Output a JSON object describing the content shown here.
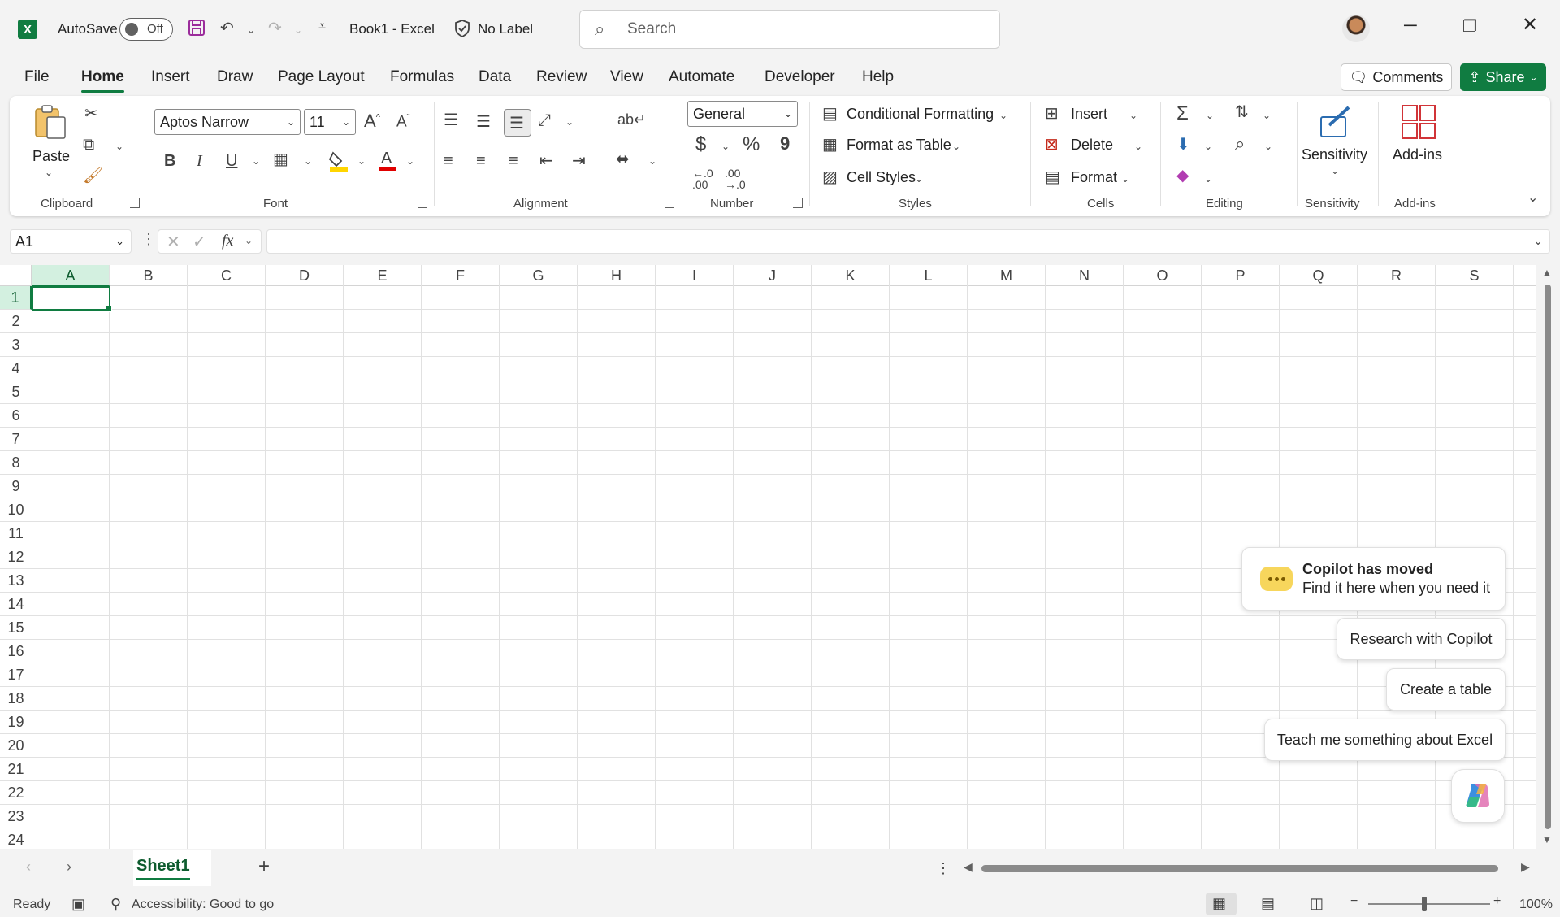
{
  "titlebar": {
    "autosave_label": "AutoSave",
    "autosave_state": "Off",
    "doc_title": "Book1  -  Excel",
    "sensitivity_label": "No Label",
    "search_placeholder": "Search"
  },
  "tabs": [
    "File",
    "Home",
    "Insert",
    "Draw",
    "Page Layout",
    "Formulas",
    "Data",
    "Review",
    "View",
    "Automate",
    "Developer",
    "Help"
  ],
  "active_tab": "Home",
  "comments_label": "Comments",
  "share_label": "Share",
  "ribbon": {
    "clipboard": {
      "paste": "Paste",
      "group": "Clipboard"
    },
    "font": {
      "name": "Aptos Narrow",
      "size": "11",
      "group": "Font",
      "bold": "B",
      "italic": "I",
      "underline": "U",
      "fill_color": "#ffd500",
      "font_color": "#e00000"
    },
    "alignment": {
      "group": "Alignment"
    },
    "number": {
      "format": "General",
      "group": "Number",
      "currency": "$",
      "percent": "%",
      "comma": "9"
    },
    "styles": {
      "conditional": "Conditional Formatting",
      "format_table": "Format as Table",
      "cell_styles": "Cell Styles",
      "group": "Styles"
    },
    "cells": {
      "insert": "Insert",
      "delete": "Delete",
      "format": "Format",
      "group": "Cells"
    },
    "editing": {
      "group": "Editing"
    },
    "sensitivity": {
      "label": "Sensitivity",
      "group": "Sensitivity"
    },
    "addins": {
      "label": "Add-ins",
      "group": "Add-ins"
    }
  },
  "formula_bar": {
    "name_box": "A1",
    "fx": "fx",
    "value": ""
  },
  "columns": [
    "A",
    "B",
    "C",
    "D",
    "E",
    "F",
    "G",
    "H",
    "I",
    "J",
    "K",
    "L",
    "M",
    "N",
    "O",
    "P",
    "Q",
    "R",
    "S"
  ],
  "rows": [
    "1",
    "2",
    "3",
    "4",
    "5",
    "6",
    "7",
    "8",
    "9",
    "10",
    "11",
    "12",
    "13",
    "14",
    "15",
    "16",
    "17",
    "18",
    "19",
    "20",
    "21",
    "22",
    "23",
    "24"
  ],
  "selected_cell": "A1",
  "copilot": {
    "title": "Copilot has moved",
    "subtitle": "Find it here when you need it",
    "suggestions": [
      "Research with Copilot",
      "Create a table",
      "Teach me something about Excel"
    ]
  },
  "sheets": [
    "Sheet1"
  ],
  "status": {
    "ready": "Ready",
    "accessibility": "Accessibility: Good to go",
    "zoom": "100%"
  },
  "accent_color": "#107c41"
}
